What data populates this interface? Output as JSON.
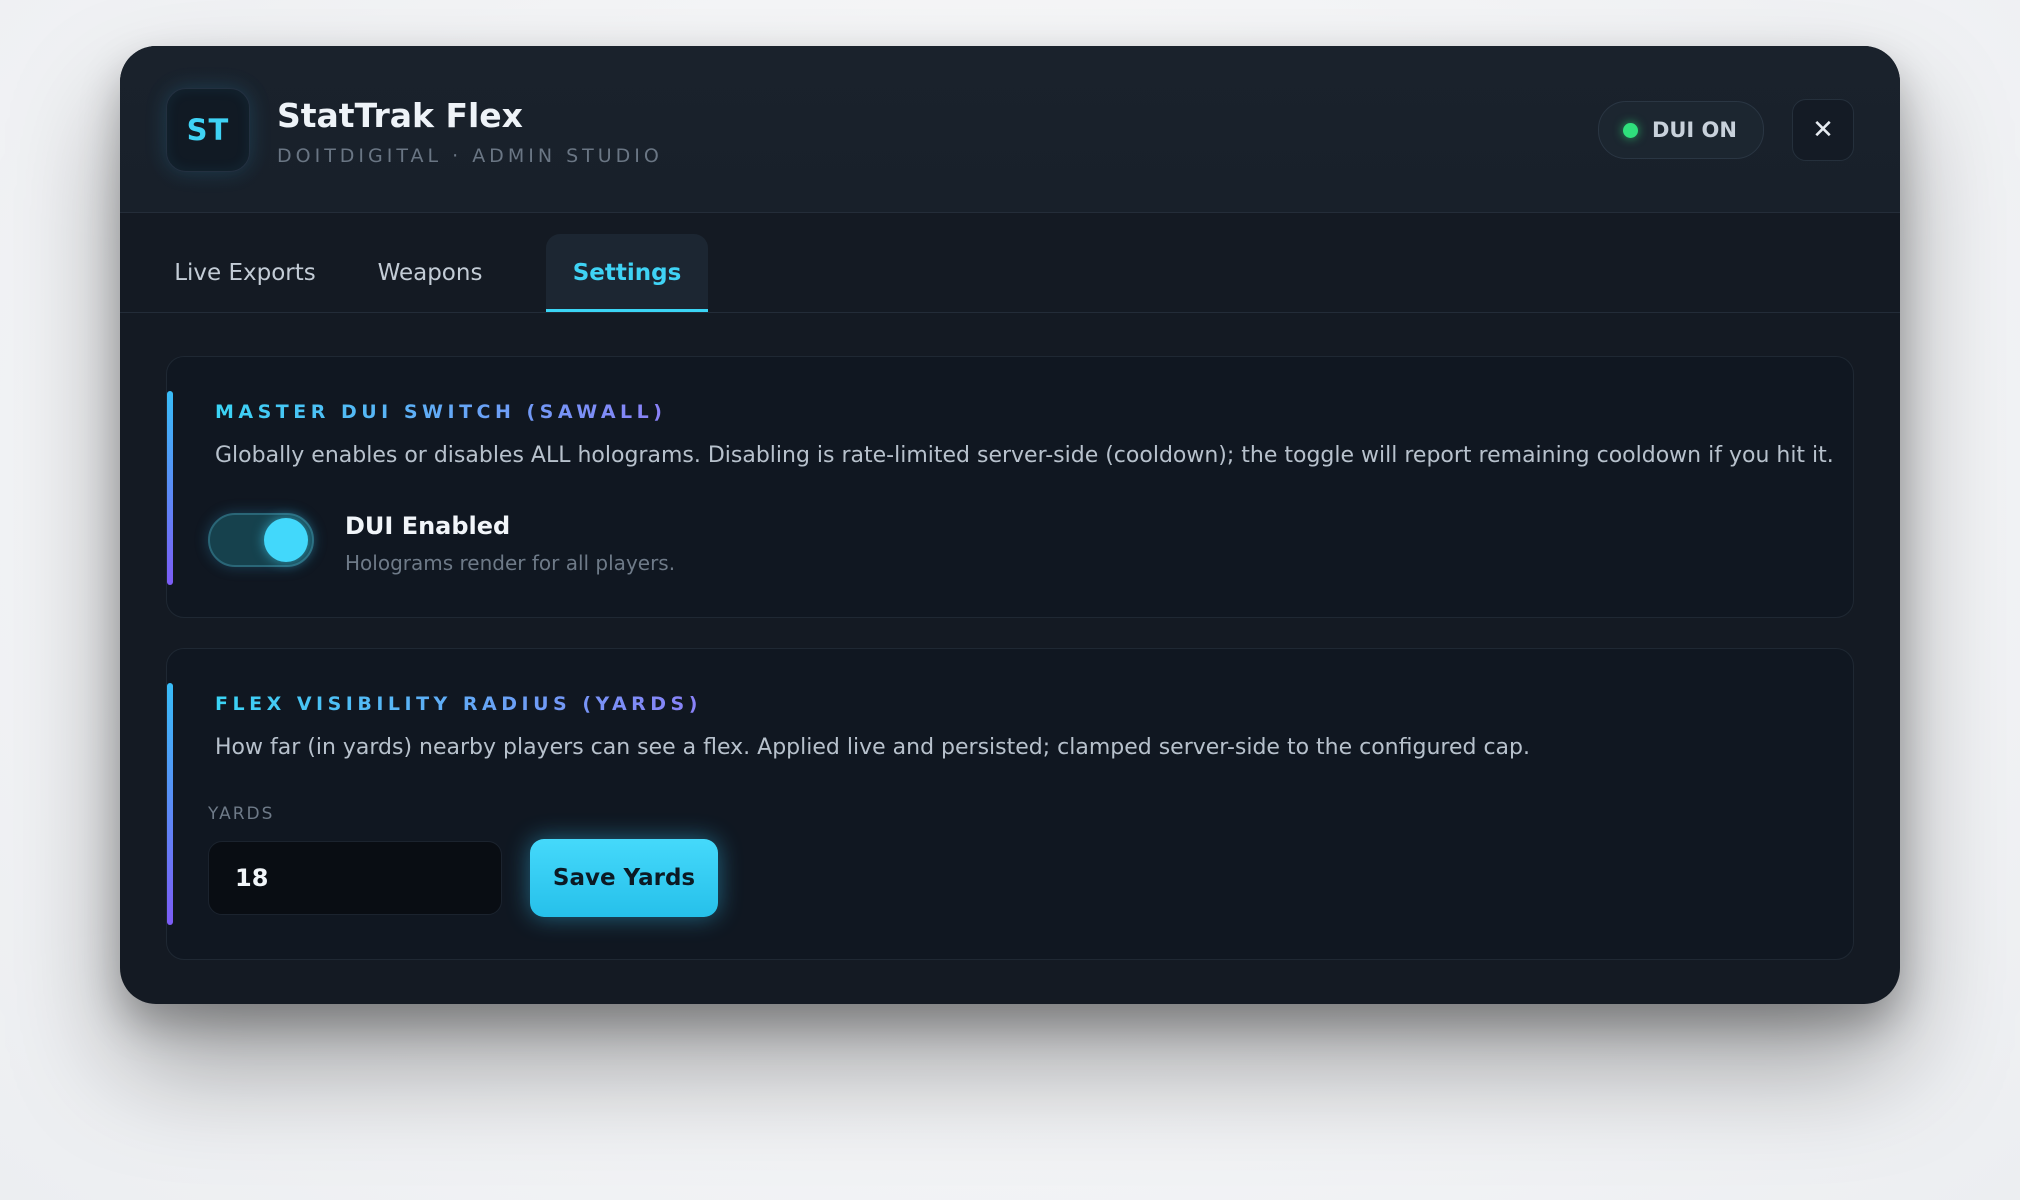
{
  "app": {
    "logo_text": "ST",
    "title": "StatTrak Flex",
    "subtitle": "DOITDIGITAL · ADMIN STUDIO",
    "status_label": "DUI ON",
    "close_glyph": "✕"
  },
  "tabs": [
    {
      "label": "Live Exports",
      "active": false
    },
    {
      "label": "Weapons",
      "active": false
    },
    {
      "label": "Settings",
      "active": true
    }
  ],
  "master_switch": {
    "heading": "MASTER DUI SWITCH (SAWALL)",
    "description": "Globally enables or disables ALL holograms. Disabling is rate-limited server-side (cooldown); the toggle will report remaining cooldown if you hit it.",
    "toggle_on": true,
    "toggle_label": "DUI Enabled",
    "toggle_sublabel": "Holograms render for all players."
  },
  "visibility_radius": {
    "heading": "FLEX VISIBILITY RADIUS (YARDS)",
    "description": "How far (in yards) nearby players can see a flex. Applied live and persisted; clamped server-side to the configured cap.",
    "field_label": "YARDS",
    "value": "18",
    "save_label": "Save Yards"
  },
  "colors": {
    "accent": "#3bd5f5",
    "accent_secondary": "#7c5cf6",
    "status_on": "#2fe07c",
    "window_bg": "#141a23"
  },
  "icons": {
    "close": "close-icon",
    "status": "status-dot-icon"
  }
}
